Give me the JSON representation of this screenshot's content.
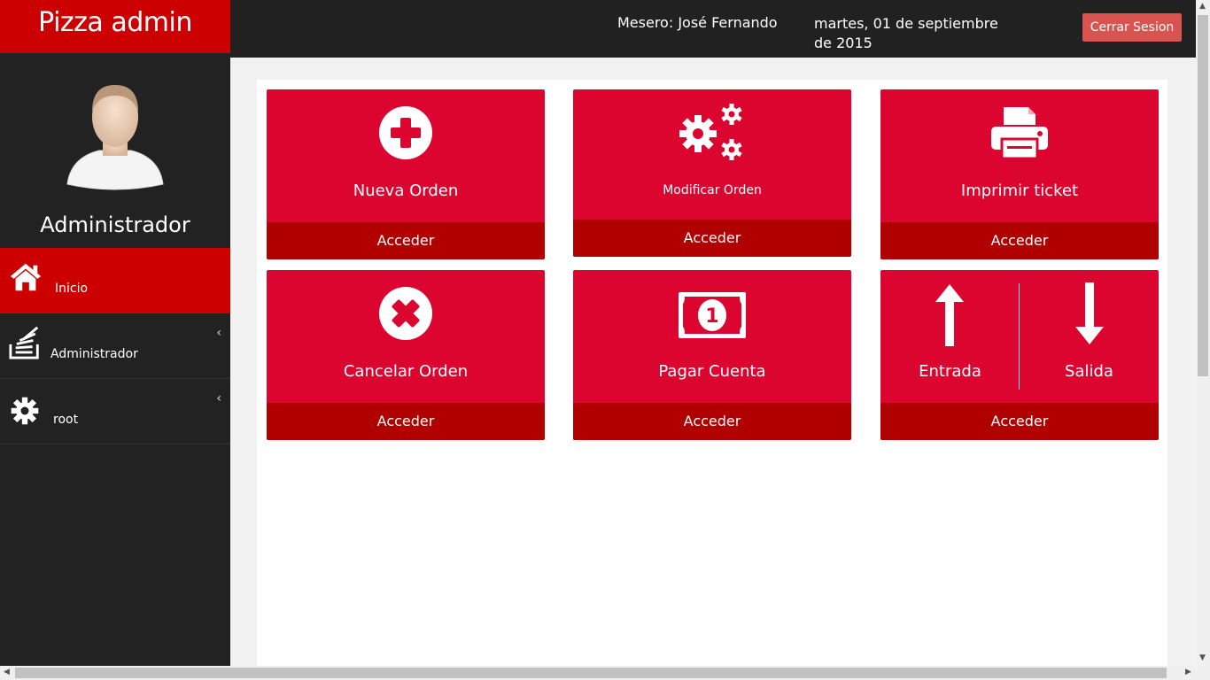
{
  "header": {
    "brand": "Pizza admin",
    "waiter": "Mesero: José Fernando",
    "date": "martes, 01 de septiembre de 2015",
    "logout_label": "Cerrar Sesion"
  },
  "sidebar": {
    "role": "Administrador",
    "items": [
      {
        "label": "Inicio",
        "icon": "home-icon",
        "active": true
      },
      {
        "label": "Administrador",
        "icon": "stack-icon",
        "active": false
      },
      {
        "label": "root",
        "icon": "gear-icon",
        "active": false
      }
    ]
  },
  "tiles": [
    {
      "title": "Nueva Orden",
      "icon": "plus-circle-icon",
      "action": "Acceder"
    },
    {
      "title": "Modificar Orden",
      "icon": "gears-icon",
      "action": "Acceder"
    },
    {
      "title": "Imprimir ticket",
      "icon": "printer-icon",
      "action": "Acceder"
    },
    {
      "title": "Cancelar Orden",
      "icon": "x-circle-icon",
      "action": "Acceder"
    },
    {
      "title": "Pagar Cuenta",
      "icon": "money-icon",
      "action": "Acceder"
    },
    {
      "title_left": "Entrada",
      "title_right": "Salida",
      "icon_left": "arrow-up-icon",
      "icon_right": "arrow-down-icon",
      "action": "Acceder"
    }
  ],
  "colors": {
    "brand": "#cc0000",
    "tile": "#dc0530",
    "tile_footer": "#b00000",
    "logout": "#d9534f",
    "dark": "#212121"
  }
}
